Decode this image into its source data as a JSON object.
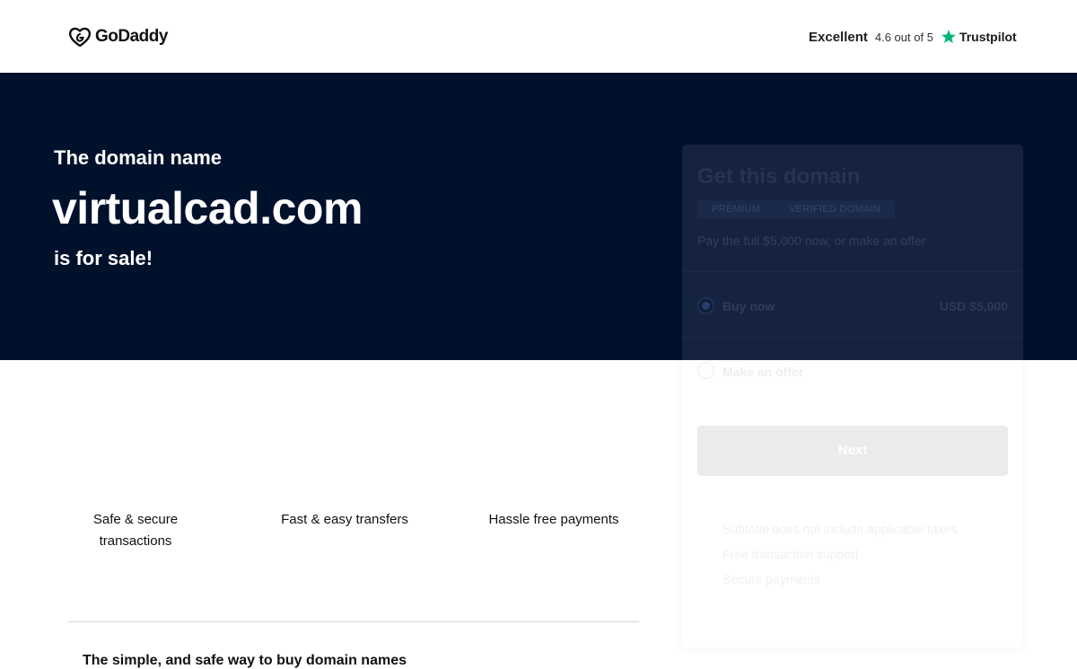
{
  "header": {
    "logo_text": "GoDaddy",
    "rating_label": "Excellent",
    "rating_score": "4.6 out of 5",
    "review_brand": "Trustpilot"
  },
  "hero": {
    "pre_text": "The domain name",
    "domain": "virtualcad.com",
    "post_text": "is for sale!"
  },
  "card": {
    "title": "Get this domain",
    "badges": [
      "PREMIUM",
      "VERIFIED DOMAIN"
    ],
    "description": "Pay the full $5,000 now, or make an offer",
    "options": [
      {
        "label": "Buy now",
        "price": "USD $5,000",
        "selected": true
      },
      {
        "label": "Make an offer",
        "selected": false
      }
    ],
    "next_label": "Next",
    "features": [
      "Subtotal does not include applicable taxes",
      "Free transaction support",
      "Secure payments"
    ]
  },
  "benefits": [
    {
      "line1": "Safe & secure",
      "line2": "transactions"
    },
    {
      "line1": "Fast & easy transfers"
    },
    {
      "line1": "Hassle free payments"
    }
  ],
  "bottom": {
    "heading": "The simple, and safe way to buy domain names"
  },
  "colors": {
    "hero_bg": "#00112c",
    "trust_star": "#00b67a"
  }
}
